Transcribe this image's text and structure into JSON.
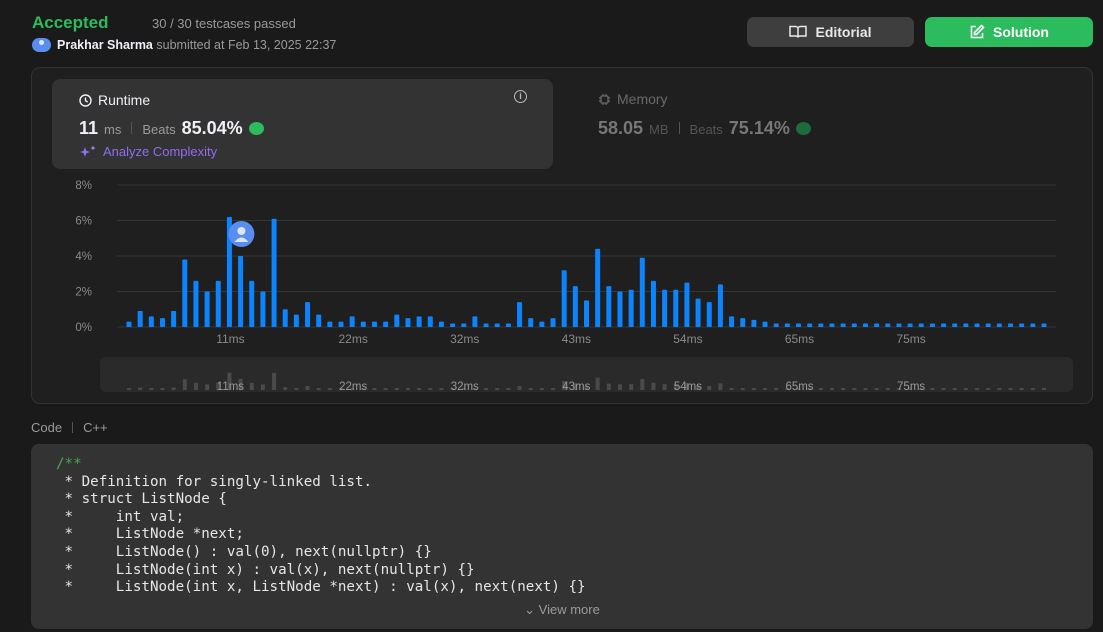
{
  "submission": {
    "status": "Accepted",
    "testcases": "30 / 30 testcases passed",
    "user": "Prakhar Sharma",
    "submitted_text": "submitted at Feb 13, 2025 22:37"
  },
  "buttons": {
    "editorial": "Editorial",
    "solution": "Solution"
  },
  "runtime": {
    "title": "Runtime",
    "value": "11",
    "unit": "ms",
    "beats_label": "Beats",
    "beats_pct": "85.04%",
    "analyze": "Analyze Complexity"
  },
  "memory": {
    "title": "Memory",
    "value": "58.05",
    "unit": "MB",
    "beats_label": "Beats",
    "beats_pct": "75.14%"
  },
  "chart_data": {
    "type": "bar",
    "ylim": [
      0,
      8
    ],
    "y_ticks": [
      "8%",
      "6%",
      "4%",
      "2%",
      "0%"
    ],
    "x_tick_labels": [
      "11ms",
      "22ms",
      "32ms",
      "43ms",
      "54ms",
      "65ms",
      "75ms"
    ],
    "grid": true,
    "highlight_label": "user-position",
    "values": [
      0.3,
      0.9,
      0.6,
      0.5,
      0.9,
      3.8,
      2.6,
      2.0,
      2.6,
      6.2,
      4.0,
      2.6,
      2.0,
      6.1,
      1.0,
      0.7,
      1.4,
      0.7,
      0.3,
      0.3,
      0.6,
      0.3,
      0.3,
      0.3,
      0.7,
      0.5,
      0.6,
      0.6,
      0.3,
      0.2,
      0.2,
      0.6,
      0.2,
      0.2,
      0.2,
      1.4,
      0.5,
      0.3,
      0.5,
      3.2,
      2.3,
      1.5,
      4.4,
      2.3,
      2.0,
      2.1,
      3.9,
      2.6,
      2.1,
      2.1,
      2.5,
      1.6,
      1.4,
      2.4,
      0.6,
      0.5,
      0.4,
      0.3,
      0.2,
      0.2,
      0.2,
      0.2,
      0.2,
      0.2,
      0.2,
      0.2,
      0.2,
      0.2,
      0.2,
      0.2,
      0.2,
      0.2,
      0.2,
      0.2,
      0.2,
      0.2,
      0.2,
      0.2,
      0.2,
      0.2,
      0.2,
      0.2,
      0.2
    ]
  },
  "code": {
    "label": "Code",
    "language": "C++",
    "lines": [
      "/**",
      " * Definition for singly-linked list.",
      " * struct ListNode {",
      " *     int val;",
      " *     ListNode *next;",
      " *     ListNode() : val(0), next(nullptr) {}",
      " *     ListNode(int x) : val(x), next(nullptr) {}",
      " *     ListNode(int x, ListNode *next) : val(x), next(next) {}"
    ],
    "view_more": "View more"
  },
  "colors": {
    "accepted": "#2cbb5d",
    "bar": "#0a84ff",
    "bar_mini": "#4a4a4a",
    "analyze": "#8d6ff0"
  }
}
